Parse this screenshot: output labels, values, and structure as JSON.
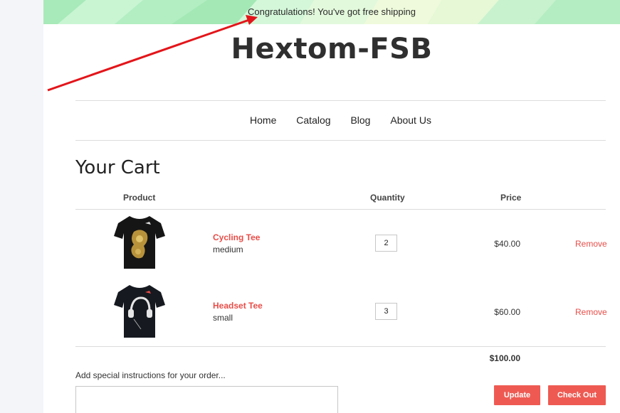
{
  "banner": {
    "text": "Congratulations! You've got free shipping"
  },
  "header": {
    "logo": "Hextom-FSB"
  },
  "nav": {
    "items": [
      "Home",
      "Catalog",
      "Blog",
      "About Us"
    ]
  },
  "cart": {
    "title": "Your Cart",
    "columns": {
      "product": "Product",
      "quantity": "Quantity",
      "price": "Price"
    },
    "items": [
      {
        "name": "Cycling Tee",
        "variant": "medium",
        "quantity": "2",
        "price": "$40.00",
        "remove": "Remove",
        "icon": "tshirt-gold-print-icon"
      },
      {
        "name": "Headset Tee",
        "variant": "small",
        "quantity": "3",
        "price": "$60.00",
        "remove": "Remove",
        "icon": "tshirt-headphones-print-icon"
      }
    ],
    "total": "$100.00",
    "instructions_label": "Add special instructions for your order...",
    "update_label": "Update",
    "checkout_label": "Check Out"
  },
  "colors": {
    "accent": "#ee5a52",
    "link": "#e84d48",
    "banner_green": "#b6f0c4",
    "arrow": "#e3151a"
  }
}
